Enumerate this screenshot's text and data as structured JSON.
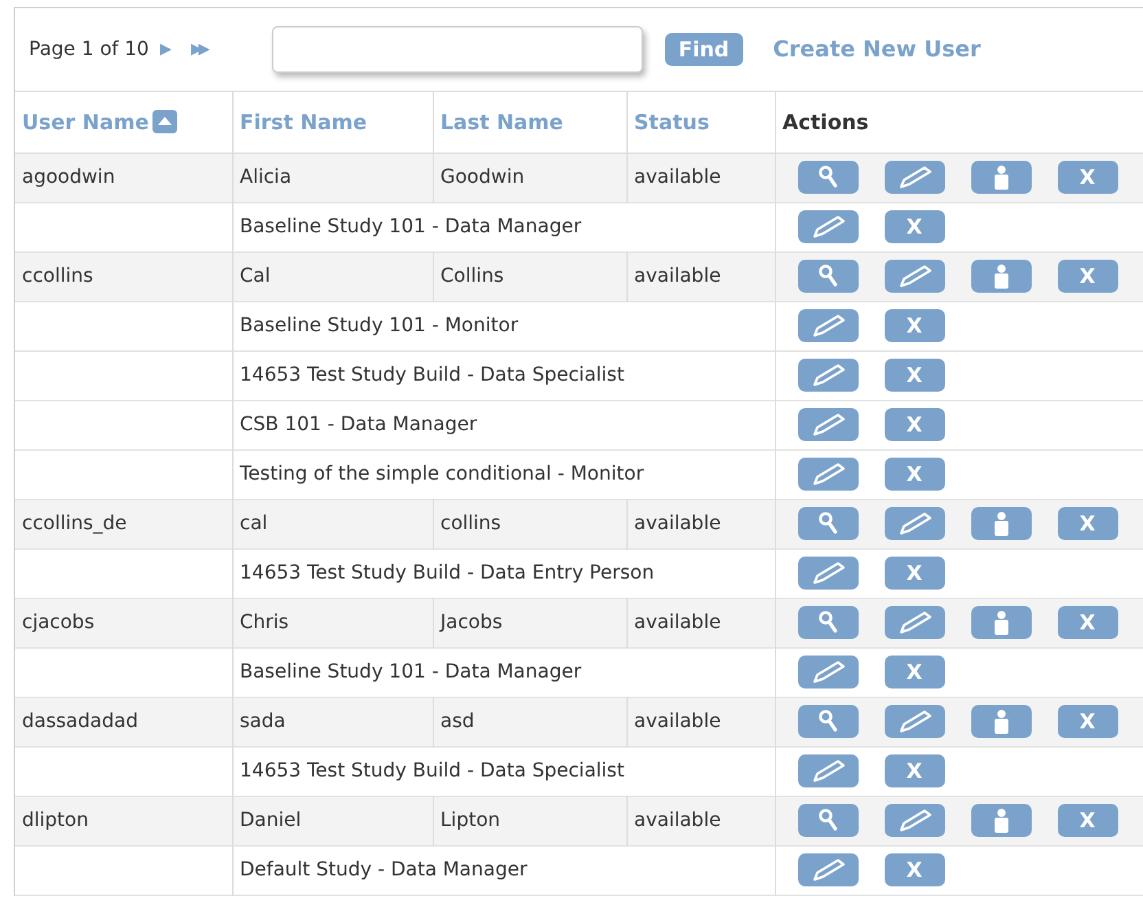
{
  "pager": {
    "label": "Page 1 of 10",
    "next": "▶",
    "last": "▶▶"
  },
  "find_button": "Find",
  "create_link": "Create New User",
  "columns": [
    {
      "label": "User Name",
      "sortable": true,
      "sorted": true
    },
    {
      "label": "First Name",
      "sortable": true,
      "sorted": false
    },
    {
      "label": "Last Name",
      "sortable": true,
      "sorted": false
    },
    {
      "label": "Status",
      "sortable": true,
      "sorted": false
    },
    {
      "label": "Actions",
      "sortable": false
    }
  ],
  "rows": [
    {
      "kind": "user",
      "user_name": "agoodwin",
      "first_name": "Alicia",
      "last_name": "Goodwin",
      "status": "available",
      "delete_label": "X"
    },
    {
      "kind": "role",
      "role": "Baseline Study 101 - Data Manager",
      "delete_label": "X"
    },
    {
      "kind": "user",
      "user_name": "ccollins",
      "first_name": "Cal",
      "last_name": "Collins",
      "status": "available",
      "delete_label": "X"
    },
    {
      "kind": "role",
      "role": "Baseline Study 101 - Monitor",
      "delete_label": "X"
    },
    {
      "kind": "role",
      "role": "14653 Test Study Build - Data Specialist",
      "delete_label": "X"
    },
    {
      "kind": "role",
      "role": "CSB 101 - Data Manager",
      "delete_label": "X"
    },
    {
      "kind": "role",
      "role": "Testing of the simple conditional - Monitor",
      "delete_label": "X"
    },
    {
      "kind": "user",
      "user_name": "ccollins_de",
      "first_name": "cal",
      "last_name": "collins",
      "status": "available",
      "delete_label": "X"
    },
    {
      "kind": "role",
      "role": "14653 Test Study Build - Data Entry Person",
      "delete_label": "X"
    },
    {
      "kind": "user",
      "user_name": "cjacobs",
      "first_name": "Chris",
      "last_name": "Jacobs",
      "status": "available",
      "delete_label": "X"
    },
    {
      "kind": "role",
      "role": "Baseline Study 101 - Data Manager",
      "delete_label": "X"
    },
    {
      "kind": "user",
      "user_name": "dassadadad",
      "first_name": "sada",
      "last_name": "asd",
      "status": "available",
      "delete_label": "X"
    },
    {
      "kind": "role",
      "role": "14653 Test Study Build - Data Specialist",
      "delete_label": "X"
    },
    {
      "kind": "user",
      "user_name": "dlipton",
      "first_name": "Daniel",
      "last_name": "Lipton",
      "status": "available",
      "delete_label": "X"
    },
    {
      "kind": "role",
      "role": "Default Study - Data Manager",
      "delete_label": "X"
    }
  ]
}
